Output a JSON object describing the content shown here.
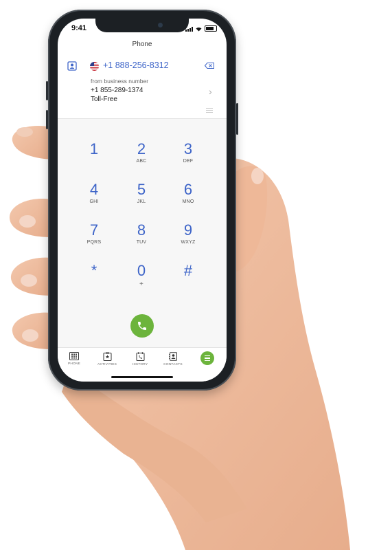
{
  "status_bar": {
    "time": "9:41"
  },
  "header": {
    "title": "Phone"
  },
  "dial": {
    "number": "+1 888-256-8312",
    "from_label": "from business number",
    "business_number": "+1 855-289-1374",
    "business_number_type": "Toll-Free"
  },
  "keypad": [
    {
      "digit": "1",
      "letters": ""
    },
    {
      "digit": "2",
      "letters": "ABC"
    },
    {
      "digit": "3",
      "letters": "DEF"
    },
    {
      "digit": "4",
      "letters": "GHI"
    },
    {
      "digit": "5",
      "letters": "JKL"
    },
    {
      "digit": "6",
      "letters": "MNO"
    },
    {
      "digit": "7",
      "letters": "PQRS"
    },
    {
      "digit": "8",
      "letters": "TUV"
    },
    {
      "digit": "9",
      "letters": "WXYZ"
    },
    {
      "digit": "*",
      "letters": ""
    },
    {
      "digit": "0",
      "letters": "+"
    },
    {
      "digit": "#",
      "letters": ""
    }
  ],
  "tabs": [
    {
      "label": "PHONE",
      "icon": "keypad-icon"
    },
    {
      "label": "ACTIVITIES",
      "icon": "clipboard-star-icon"
    },
    {
      "label": "HISTORY",
      "icon": "calendar-phone-icon"
    },
    {
      "label": "CONTACTS",
      "icon": "contacts-icon"
    }
  ],
  "colors": {
    "accent_blue": "#3d64c8",
    "call_green": "#6cb43c",
    "frame": "#1c2024"
  }
}
